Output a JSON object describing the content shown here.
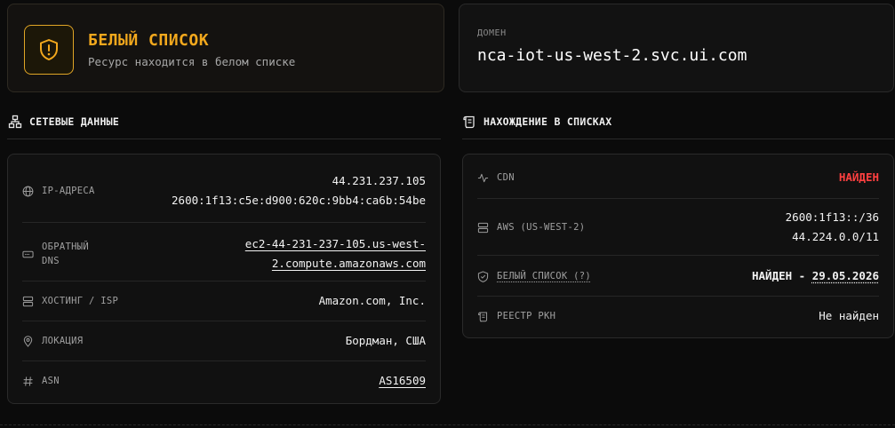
{
  "status": {
    "title": "БЕЛЫЙ СПИСОК",
    "subtitle": "Ресурс находится в белом списке",
    "accent_color": "#f2a81d",
    "icon": "shield-exclamation-icon"
  },
  "domain": {
    "label": "ДОМЕН",
    "value": "nca-iot-us-west-2.svc.ui.com"
  },
  "network": {
    "heading": "СЕТЕВЫЕ ДАННЫЕ",
    "icon": "network-icon",
    "rows": {
      "ip": {
        "label": "IP-АДРЕСА",
        "values": [
          "44.231.237.105",
          "2600:1f13:c5e:d900:620c:9bb4:ca6b:54be"
        ],
        "icon": "globe-icon"
      },
      "rdns": {
        "label_line1": "ОБРАТНЫЙ",
        "label_line2": "DNS",
        "value_line1": "ec2-44-231-237-105.us-west-",
        "value_line2": "2.compute.amazonaws.com",
        "icon": "server-dots-icon"
      },
      "hosting": {
        "label": "ХОСТИНГ / ISP",
        "value": "Amazon.com, Inc.",
        "icon": "server-icon"
      },
      "location": {
        "label": "ЛОКАЦИЯ",
        "value": "Бордман, США",
        "icon": "map-pin-icon"
      },
      "asn": {
        "label": "ASN",
        "value": "AS16509",
        "icon": "hash-icon"
      }
    }
  },
  "lists": {
    "heading": "НАХОЖДЕНИЕ В СПИСКАХ",
    "icon": "scroll-icon",
    "rows": {
      "cdn": {
        "label": "CDN",
        "value": "НАЙДЕН",
        "value_color": "#ff4040",
        "icon": "activity-icon"
      },
      "aws": {
        "label": "AWS (US-WEST-2)",
        "values": [
          "2600:1f13::/36",
          "44.224.0.0/11"
        ],
        "icon": "server-icon"
      },
      "whitelist": {
        "label": "БЕЛЫЙ СПИСОК (?)",
        "value_prefix": "НАЙДЕН - ",
        "value_date": "29.05.2026",
        "icon": "shield-check-icon"
      },
      "rkn": {
        "label": "РЕЕСТР РКН",
        "value": "Не найден",
        "icon": "scroll-icon"
      }
    }
  }
}
